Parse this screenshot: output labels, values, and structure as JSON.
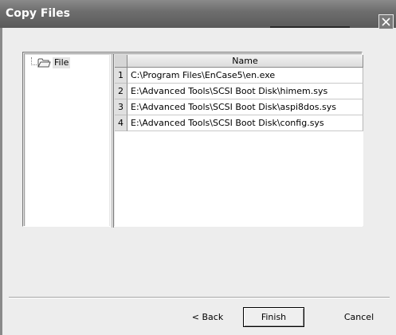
{
  "window": {
    "title": "Copy Files",
    "close_label": "Close"
  },
  "tree": {
    "items": [
      {
        "label": "File",
        "icon": "folder-icon"
      }
    ]
  },
  "grid": {
    "columns": [
      "Name"
    ],
    "rows": [
      {
        "num": "1",
        "name": "C:\\Program Files\\EnCase5\\en.exe"
      },
      {
        "num": "2",
        "name": "E:\\Advanced Tools\\SCSI Boot Disk\\himem.sys"
      },
      {
        "num": "3",
        "name": "E:\\Advanced Tools\\SCSI Boot Disk\\aspi8dos.sys"
      },
      {
        "num": "4",
        "name": "E:\\Advanced Tools\\SCSI Boot Disk\\config.sys"
      }
    ]
  },
  "buttons": {
    "back": "< Back",
    "finish": "Finish",
    "cancel": "Cancel"
  }
}
